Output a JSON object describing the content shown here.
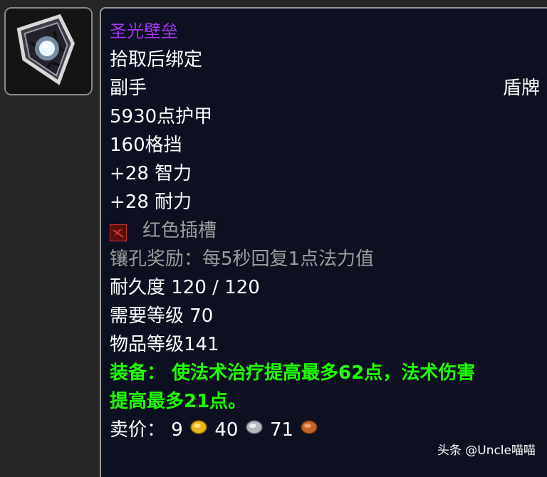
{
  "item": {
    "name": "圣光壁垒",
    "bind": "拾取后绑定",
    "slot": "副手",
    "type": "盾牌",
    "armor": "5930点护甲",
    "block": "160格挡",
    "stat_int": "+28 智力",
    "stat_sta": "+28 耐力",
    "socket_label": "红色插槽",
    "socket_bonus": "镶孔奖励：每5秒回复1点法力值",
    "durability": "耐久度 120 / 120",
    "required_level": "需要等级 70",
    "item_level": "物品等级141",
    "equip_line1": "装备：  使法术治疗提高最多62点，法术伤害",
    "equip_line2": "提高最多21点。",
    "sell_label": "卖价：",
    "sell_gold": "9",
    "sell_silver": "40",
    "sell_copper": "71"
  },
  "colors": {
    "epic": "#a335ee",
    "white": "#ffffff",
    "gray": "#9d9d9d",
    "green": "#1eff00",
    "tooltip_bg": "#0c1020"
  },
  "icons": {
    "item_icon": "shield-icon",
    "socket_icon": "red-socket-icon",
    "coins": [
      "gold-coin-icon",
      "silver-coin-icon",
      "copper-coin-icon"
    ]
  },
  "watermark": "头条 @Uncle喵喵"
}
